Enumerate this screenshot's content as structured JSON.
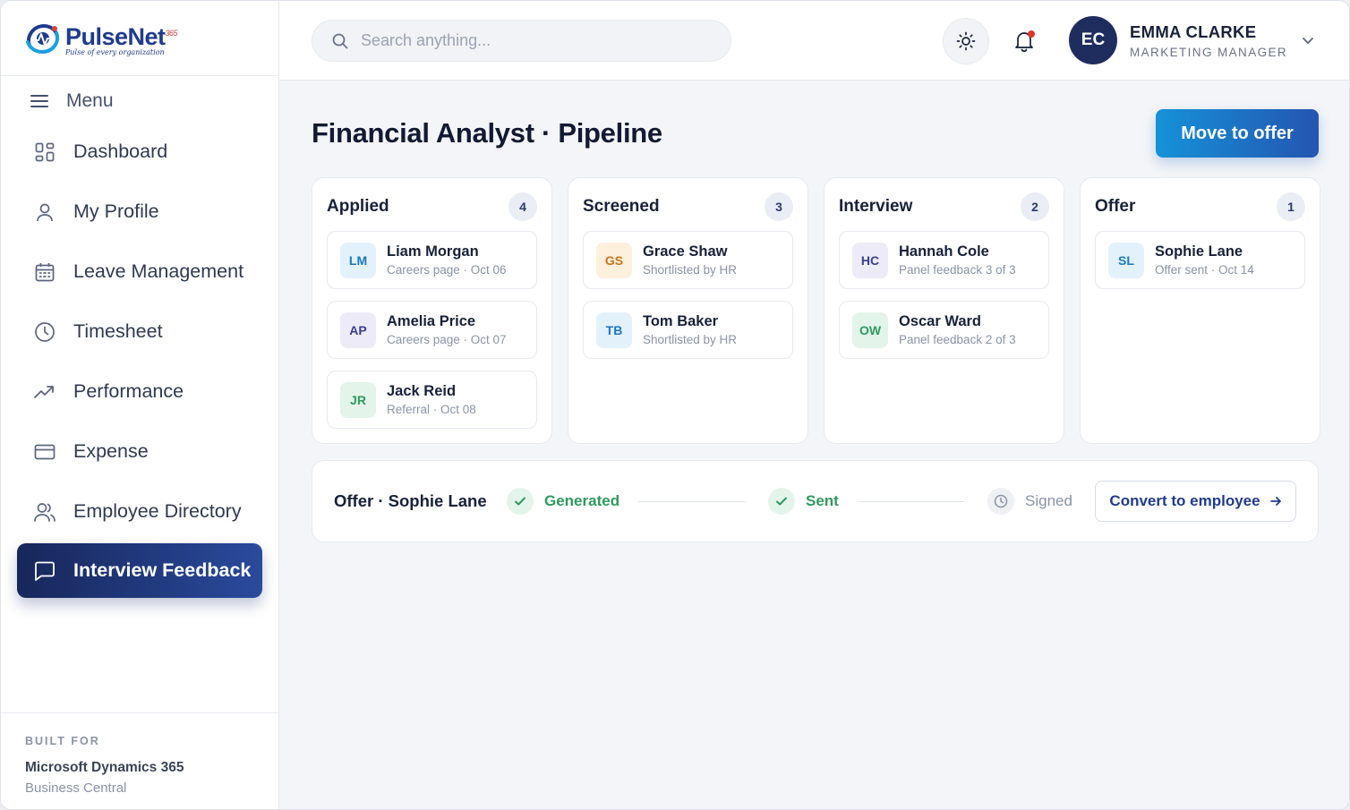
{
  "brand": {
    "name": "PulseNet",
    "suffix": "365",
    "tagline": "Pulse of every organization"
  },
  "menu": {
    "label": "Menu"
  },
  "nav": [
    {
      "label": "Dashboard",
      "icon": "dashboard-icon"
    },
    {
      "label": "My Profile",
      "icon": "user-icon"
    },
    {
      "label": "Leave Management",
      "icon": "calendar-icon"
    },
    {
      "label": "Timesheet",
      "icon": "clock-icon"
    },
    {
      "label": "Performance",
      "icon": "trend-icon"
    },
    {
      "label": "Expense",
      "icon": "card-icon"
    },
    {
      "label": "Employee Directory",
      "icon": "users-icon"
    },
    {
      "label": "Interview Feedback",
      "icon": "message-icon",
      "active": true
    }
  ],
  "built_for": {
    "label": "BUILT FOR",
    "product": "Microsoft Dynamics 365",
    "edition": "Business Central"
  },
  "header": {
    "search_placeholder": "Search anything...",
    "user": {
      "initials": "EC",
      "name": "EMMA CLARKE",
      "role": "MARKETING MANAGER"
    }
  },
  "page": {
    "title": "Financial Analyst · Pipeline",
    "primary_action": "Move to offer"
  },
  "columns": [
    {
      "title": "Applied",
      "count": "4",
      "cards": [
        {
          "initials": "LM",
          "name": "Liam Morgan",
          "meta": "Careers page · Oct 06"
        },
        {
          "initials": "AP",
          "name": "Amelia Price",
          "meta": "Careers page · Oct 07"
        },
        {
          "initials": "JR",
          "name": "Jack Reid",
          "meta": "Referral · Oct 08"
        }
      ]
    },
    {
      "title": "Screened",
      "count": "3",
      "cards": [
        {
          "initials": "GS",
          "name": "Grace Shaw",
          "meta": "Shortlisted by HR"
        },
        {
          "initials": "TB",
          "name": "Tom Baker",
          "meta": "Shortlisted by HR"
        }
      ]
    },
    {
      "title": "Interview",
      "count": "2",
      "cards": [
        {
          "initials": "HC",
          "name": "Hannah Cole",
          "meta": "Panel feedback 3 of 3"
        },
        {
          "initials": "OW",
          "name": "Oscar Ward",
          "meta": "Panel feedback 2 of 3"
        }
      ]
    },
    {
      "title": "Offer",
      "count": "1",
      "cards": [
        {
          "initials": "SL",
          "name": "Sophie Lane",
          "meta": "Offer sent · Oct 14"
        }
      ]
    }
  ],
  "offer": {
    "title": "Offer · Sophie Lane",
    "steps": [
      {
        "label": "Generated",
        "state": "done"
      },
      {
        "label": "Sent",
        "state": "done"
      },
      {
        "label": "Signed",
        "state": "pending"
      }
    ],
    "action": "Convert to employee"
  },
  "colors": {
    "accent": "#1f3b8f",
    "active_nav": "#17275a",
    "success": "#2e9a5e",
    "avatar_blue": {
      "bg": "#e3f1fb",
      "fg": "#1a78c2"
    },
    "avatar_purple": {
      "bg": "#ecebf7",
      "fg": "#3a3f8f"
    },
    "avatar_green": {
      "bg": "#e3f4ea",
      "fg": "#2e9a5e"
    },
    "avatar_orange": {
      "bg": "#fdf0dd",
      "fg": "#c8741b"
    }
  }
}
